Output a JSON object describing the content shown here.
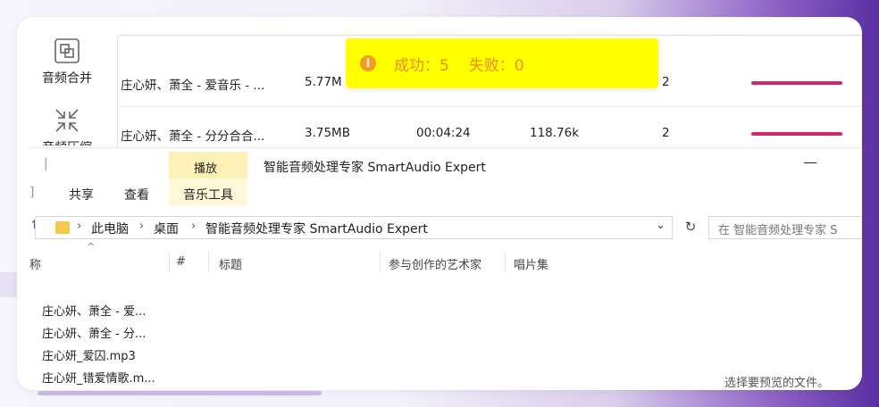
{
  "app": {
    "sidebar": [
      {
        "label": "音频合并",
        "icon": "merge-icon"
      },
      {
        "label": "音频压缩",
        "icon": "compress-icon"
      }
    ],
    "rows": [
      {
        "name": "庄心妍、萧全 - 爱音乐 - ...",
        "size": "5.77M",
        "duration": "",
        "bitrate": "",
        "channels": "2"
      },
      {
        "name": "庄心妍、萧全 - 分分合合...",
        "size": "3.75MB",
        "duration": "00:04:24",
        "bitrate": "118.76k",
        "channels": "2"
      }
    ],
    "toast": {
      "success": "成功：5",
      "fail": "失败：0",
      "icon": "info-icon"
    }
  },
  "explorer": {
    "ribbon": {
      "context_tab": "播放",
      "tabs": [
        "共享",
        "查看",
        "音乐工具"
      ]
    },
    "title": "智能音频处理专家 SmartAudio Expert",
    "minimize": "—",
    "breadcrumb": [
      "此电脑",
      "桌面",
      "智能音频处理专家 SmartAudio Expert"
    ],
    "search_placeholder": "在 智能音频处理专家 S",
    "columns": [
      "称",
      "#",
      "标题",
      "参与创作的艺术家",
      "唱片集"
    ],
    "files": [
      "庄心妍、萧全 - 爱...",
      "庄心妍、萧全 - 分...",
      "庄心妍_爱囚.mp3",
      "庄心妍_错爱情歌.m..."
    ],
    "preview_note": "选择要预览的文件。"
  },
  "colors": {
    "accent_bar": "#d4266a",
    "toast_bg": "#ffff00",
    "toast_text": "#f08a24"
  }
}
